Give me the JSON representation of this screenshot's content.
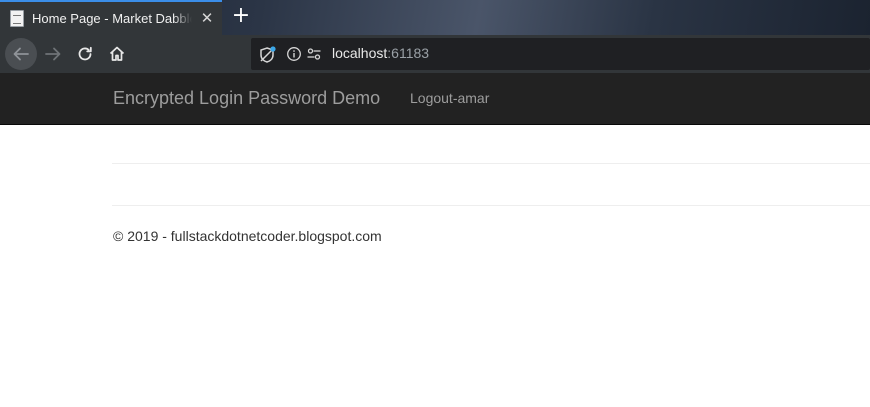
{
  "browser": {
    "tab": {
      "title": "Home Page - Market Dabblers",
      "close_glyph": "✕",
      "favicon_icon": "page-icon"
    },
    "new_tab_glyph": "+",
    "toolbar": {
      "back_icon": "arrow-left-icon",
      "forward_icon": "arrow-right-icon",
      "reload_icon": "reload-icon",
      "home_icon": "home-icon",
      "tracking_icon": "tracking-protection-icon",
      "info_icon": "info-icon",
      "permissions_icon": "permissions-icon"
    },
    "url": {
      "host": "localhost",
      "port": ":61183"
    },
    "accent_color": "#3b8ee8"
  },
  "site": {
    "navbar": {
      "brand": "Encrypted Login Password Demo",
      "links": [
        {
          "label": "Logout-amar"
        }
      ]
    },
    "footer": {
      "text": "© 2019 - fullstackdotnetcoder.blogspot.com"
    }
  }
}
